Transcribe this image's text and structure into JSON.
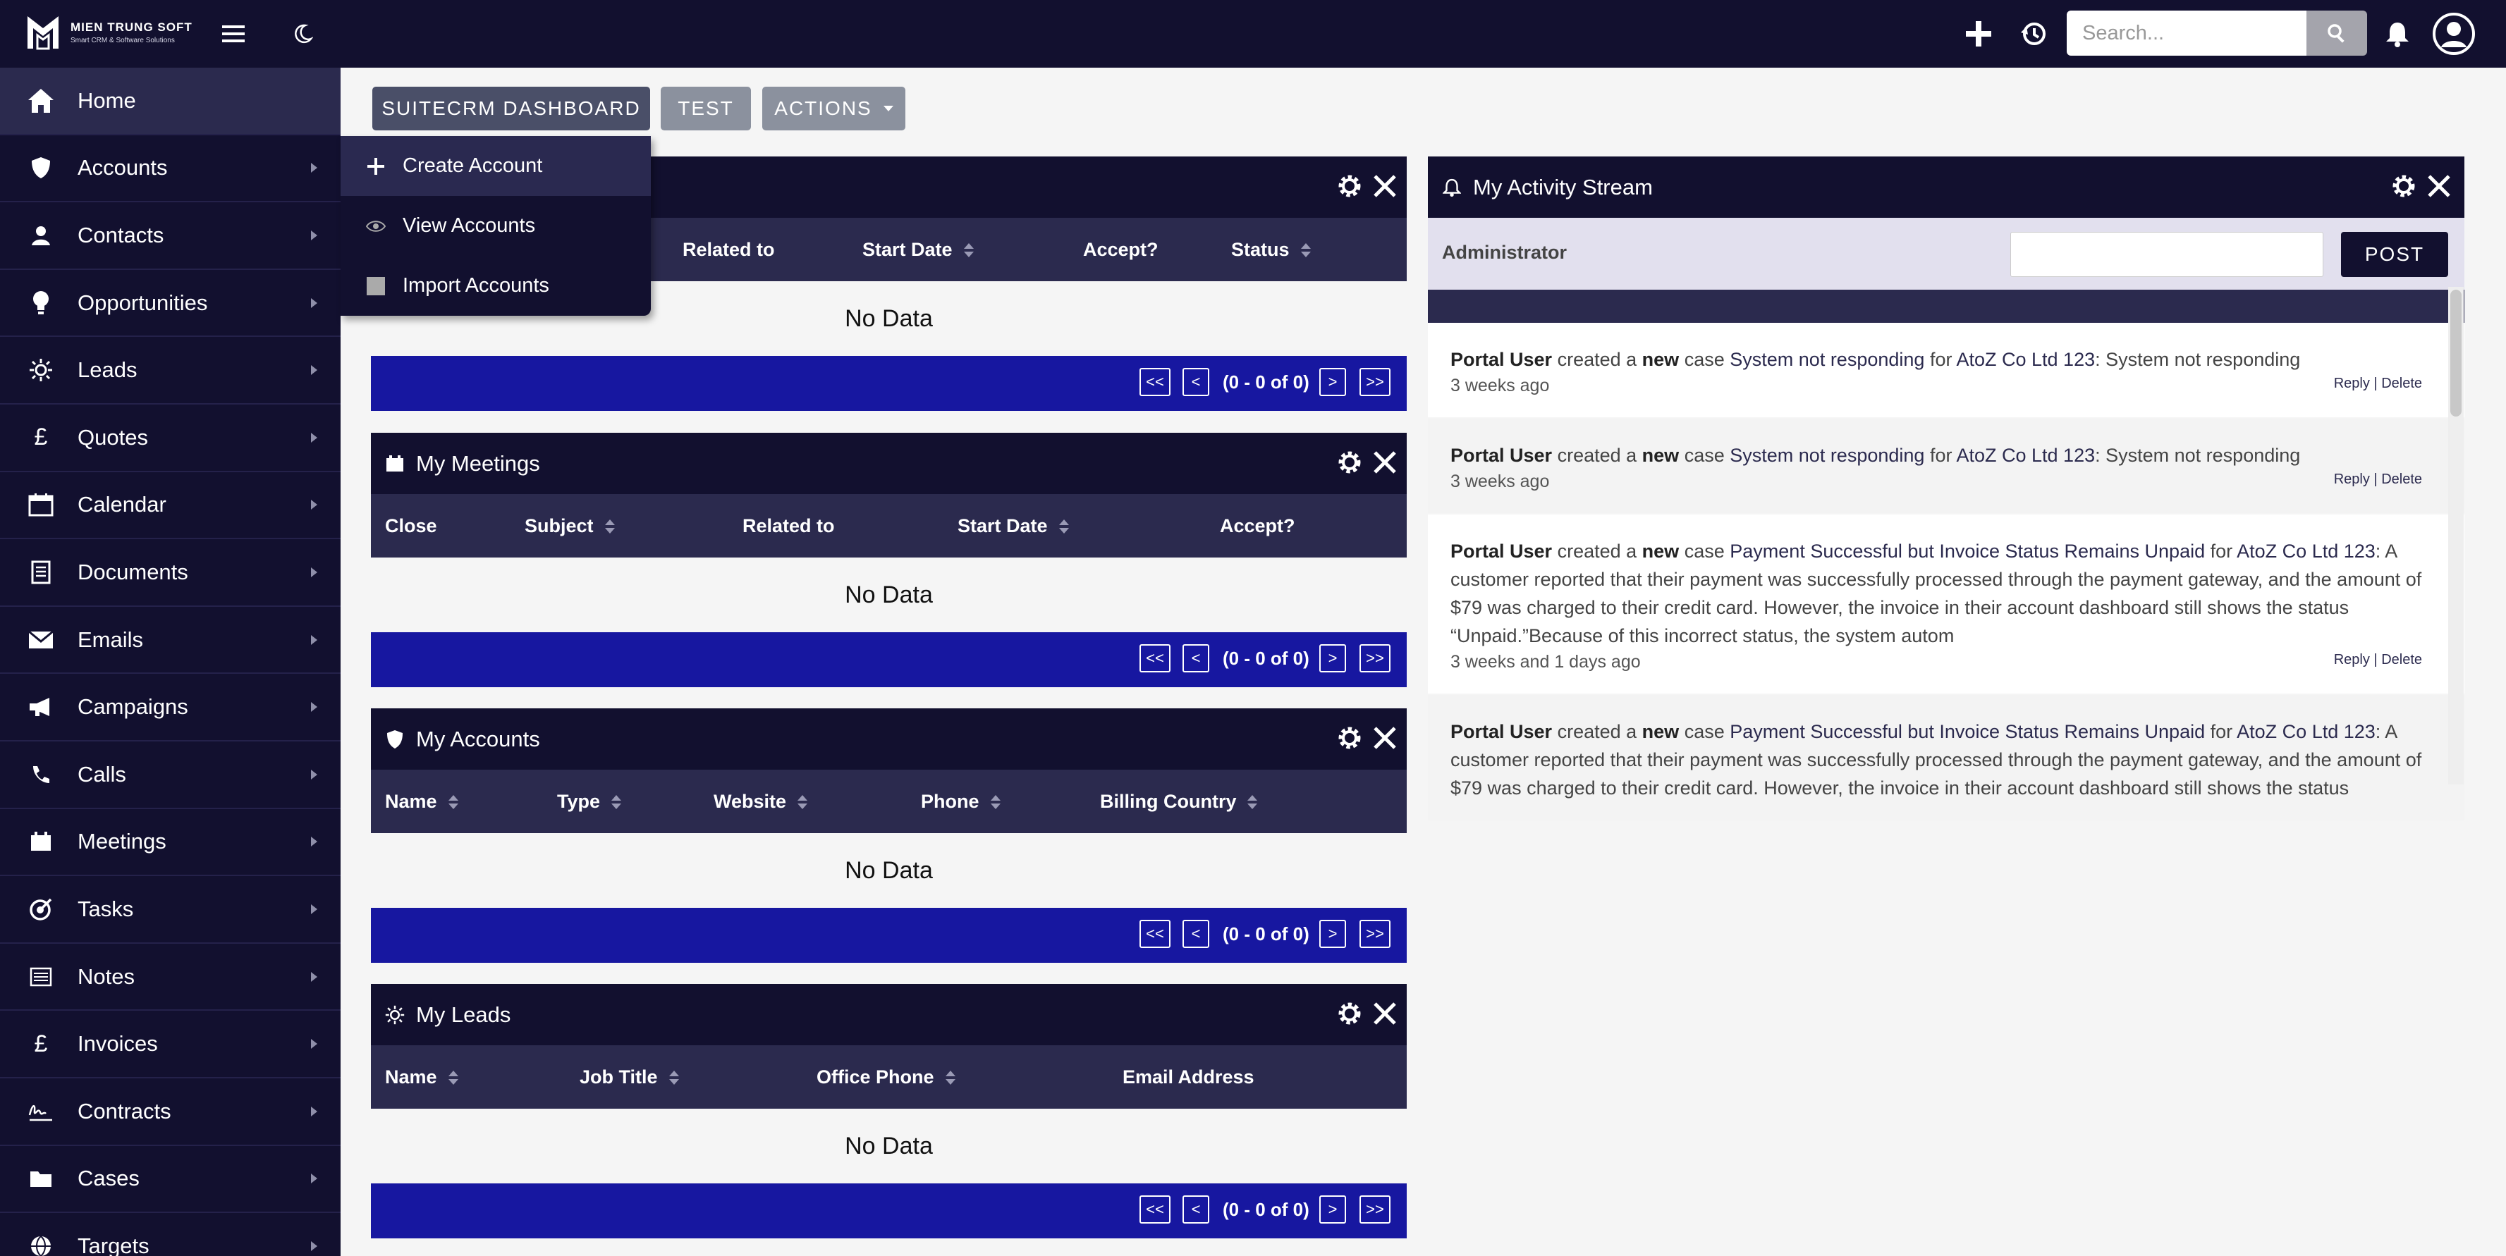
{
  "brand": {
    "name": "MIEN TRUNG SOFT",
    "tagline": "Smart CRM & Software Solutions"
  },
  "search": {
    "placeholder": "Search..."
  },
  "sidebar": {
    "items": [
      {
        "label": "Home",
        "icon": "home-icon"
      },
      {
        "label": "Accounts",
        "icon": "shield-icon"
      },
      {
        "label": "Contacts",
        "icon": "person-icon"
      },
      {
        "label": "Opportunities",
        "icon": "lightbulb-icon"
      },
      {
        "label": "Leads",
        "icon": "sun-icon"
      },
      {
        "label": "Quotes",
        "icon": "pound-icon"
      },
      {
        "label": "Calendar",
        "icon": "calendar-icon"
      },
      {
        "label": "Documents",
        "icon": "document-icon"
      },
      {
        "label": "Emails",
        "icon": "envelope-icon"
      },
      {
        "label": "Campaigns",
        "icon": "megaphone-icon"
      },
      {
        "label": "Calls",
        "icon": "phone-icon"
      },
      {
        "label": "Meetings",
        "icon": "meeting-icon"
      },
      {
        "label": "Tasks",
        "icon": "target-icon"
      },
      {
        "label": "Notes",
        "icon": "notes-icon"
      },
      {
        "label": "Invoices",
        "icon": "pound-icon"
      },
      {
        "label": "Contracts",
        "icon": "signature-icon"
      },
      {
        "label": "Cases",
        "icon": "folder-icon"
      },
      {
        "label": "Targets",
        "icon": "globe-icon"
      }
    ]
  },
  "accounts_menu": {
    "items": [
      {
        "label": "Create Account"
      },
      {
        "label": "View Accounts"
      },
      {
        "label": "Import Accounts"
      }
    ]
  },
  "toolbar": {
    "dashboard_label": "SUITECRM DASHBOARD",
    "test_label": "TEST",
    "actions_label": "ACTIONS"
  },
  "dashlets": {
    "calls": {
      "columns": [
        "Related to",
        "Start Date",
        "Accept?",
        "Status"
      ],
      "empty": "No Data",
      "pager": {
        "first": "<<",
        "prev": "<",
        "info": "(0 - 0 of 0)",
        "next": ">",
        "last": ">>"
      }
    },
    "meetings": {
      "title": "My Meetings",
      "columns": [
        "Close",
        "Subject",
        "Related to",
        "Start Date",
        "Accept?"
      ],
      "empty": "No Data",
      "pager": {
        "first": "<<",
        "prev": "<",
        "info": "(0 - 0 of 0)",
        "next": ">",
        "last": ">>"
      }
    },
    "accounts": {
      "title": "My Accounts",
      "columns": [
        "Name",
        "Type",
        "Website",
        "Phone",
        "Billing Country"
      ],
      "empty": "No Data",
      "pager": {
        "first": "<<",
        "prev": "<",
        "info": "(0 - 0 of 0)",
        "next": ">",
        "last": ">>"
      }
    },
    "leads": {
      "title": "My Leads",
      "columns": [
        "Name",
        "Job Title",
        "Office Phone",
        "Email Address"
      ],
      "empty": "No Data",
      "pager": {
        "first": "<<",
        "prev": "<",
        "info": "(0 - 0 of 0)",
        "next": ">",
        "last": ">>"
      }
    }
  },
  "activity_stream": {
    "title": "My Activity Stream",
    "user": "Administrator",
    "post_label": "POST",
    "reply_label": "Reply",
    "separator": "|",
    "delete_label": "Delete",
    "entries": [
      {
        "actor": "Portal User",
        "verb": "created a",
        "new_word": "new",
        "object": "case",
        "subject": "System not responding",
        "for_word": "for",
        "account": "AtoZ Co Ltd 123",
        "detail": ": System not responding",
        "time": "3 weeks ago"
      },
      {
        "actor": "Portal User",
        "verb": "created a",
        "new_word": "new",
        "object": "case",
        "subject": "System not responding",
        "for_word": "for",
        "account": "AtoZ Co Ltd 123",
        "detail": ": System not responding",
        "time": "3 weeks ago"
      },
      {
        "actor": "Portal User",
        "verb": "created a",
        "new_word": "new",
        "object": "case",
        "subject": "Payment Successful but Invoice Status Remains Unpaid",
        "for_word": "for",
        "account": "AtoZ Co Ltd 123",
        "detail": ": A customer reported that their payment was successfully processed through the payment gateway, and the amount of $79 was charged to their credit card. However, the invoice in their account dashboard still shows the status “Unpaid.”Because of this incorrect status, the system autom",
        "time": "3 weeks and 1 days ago"
      },
      {
        "actor": "Portal User",
        "verb": "created a",
        "new_word": "new",
        "object": "case",
        "subject": "Payment Successful but Invoice Status Remains Unpaid",
        "for_word": "for",
        "account": "AtoZ Co Ltd 123",
        "detail": ": A customer reported that their payment was successfully processed through the payment gateway, and the amount of $79 was charged to their credit card. However, the invoice in their account dashboard still shows the status",
        "time": ""
      }
    ]
  },
  "colors": {
    "navy": "#12102f",
    "band": "#2b2a4e",
    "pager": "#1717a0",
    "background": "#f5f5f5"
  }
}
